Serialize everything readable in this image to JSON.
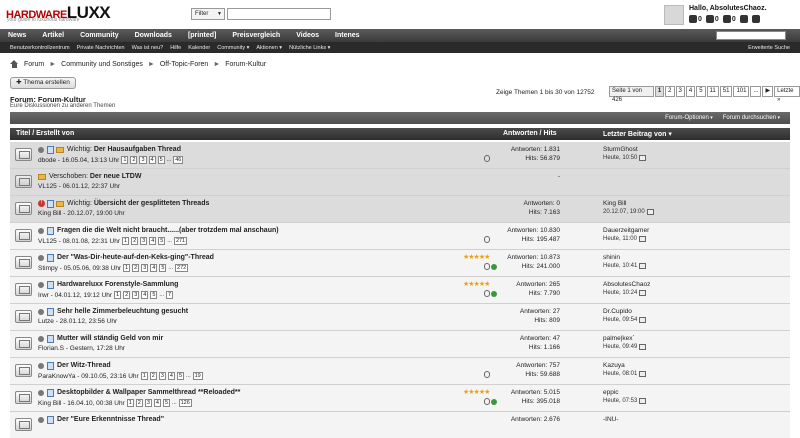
{
  "brand": {
    "logo_part1": "HARDWARE",
    "logo_part2": "LUXX",
    "tagline": "your guide to luxurious hardware"
  },
  "header": {
    "filter_label": "Filter",
    "search_placeholder": "",
    "greeting": "Hallo, AbsolutesChaoz.",
    "counts": [
      "0",
      "0",
      "0"
    ]
  },
  "nav": {
    "items": [
      "News",
      "Artikel",
      "Community",
      "Downloads",
      "[printed]",
      "Preisvergleich",
      "Videos",
      "Intenes"
    ]
  },
  "subnav": {
    "items": [
      "Benutzerkontrollzentrum",
      "Private Nachrichten",
      "Was ist neu?",
      "Hilfe",
      "Kalender",
      "Community ▾",
      "Aktionen ▾",
      "Nützliche Links ▾"
    ],
    "advanced": "Erweiterte Suche"
  },
  "breadcrumb": [
    "Forum",
    "Community und Sonstiges",
    "Off-Topic-Foren",
    "Forum-Kultur"
  ],
  "new_thread_label": "✚ Thema erstellen",
  "forum": {
    "title": "Forum: Forum-Kultur",
    "description": "Eure Diskussionen zu anderen Themen"
  },
  "showing": "Zeige Themen 1 bis 30 von 12752",
  "pager": {
    "label": "Seite 1 von 426",
    "pages": [
      "1",
      "2",
      "3",
      "4",
      "5",
      "11",
      "51",
      "101",
      "...",
      "▶"
    ],
    "last": "Letzte »"
  },
  "toolbar": {
    "options": "Forum-Optionen",
    "search": "Forum durchsuchen"
  },
  "columns": {
    "title": "Titel / Erstellt von",
    "replies": "Antworten / Hits",
    "last": "Letzter Beitrag von ▾"
  },
  "threads": [
    {
      "prefix": "Wichtig:",
      "title": "Der Hausaufgaben Thread",
      "author": "dbode - 16.05.04, 13:13 Uhr",
      "pages": [
        "1",
        "2",
        "3",
        "4",
        "5"
      ],
      "last_page": "46",
      "replies": "Antworten: 1.831",
      "hits": "Hits: 56.879",
      "last_user": "SturmGhost",
      "last_time": "Heute, 10:50",
      "sticky": true,
      "stars": "",
      "moved": false
    },
    {
      "prefix": "Verschoben:",
      "title": "Der neue LTDW",
      "author": "VL125 - 06.01.12, 22:37 Uhr",
      "pages": [],
      "last_page": "",
      "replies": "-",
      "hits": "",
      "last_user": "",
      "last_time": "",
      "sticky": true,
      "stars": "",
      "moved": true
    },
    {
      "prefix": "Wichtig:",
      "title": "Übersicht der gesplitteten Threads",
      "author": "King Bill - 20.12.07, 19:00 Uhr",
      "pages": [],
      "last_page": "",
      "replies": "Antworten: 0",
      "hits": "Hits: 7.163",
      "last_user": "King Bill",
      "last_time": "20.12.07, 19:00",
      "sticky": true,
      "stars": "",
      "moved": false
    },
    {
      "prefix": "",
      "title": "Fragen die die Welt nicht braucht......(aber trotzdem mal anschaun)",
      "author": "VL125 - 08.01.08, 22:31 Uhr",
      "pages": [
        "1",
        "2",
        "3",
        "4",
        "5"
      ],
      "last_page": "271",
      "replies": "Antworten: 10.830",
      "hits": "Hits: 195.487",
      "last_user": "Dauerzeitgamer",
      "last_time": "Heute, 11:00",
      "sticky": false,
      "stars": "",
      "moved": false
    },
    {
      "prefix": "",
      "title": "Der \"Was-Dir-heute-auf-den-Keks-ging\"-Thread",
      "author": "Stimpy - 05.05.06, 09:38 Uhr",
      "pages": [
        "1",
        "2",
        "3",
        "4",
        "5"
      ],
      "last_page": "272",
      "replies": "Antworten: 10.873",
      "hits": "Hits: 241.000",
      "last_user": "shinin",
      "last_time": "Heute, 10:41",
      "sticky": false,
      "stars": "★★★★★",
      "moved": false
    },
    {
      "prefix": "",
      "title": "Hardwareluxx Forenstyle-Sammlung",
      "author": "Irwr - 04.01.12, 19:12 Uhr",
      "pages": [
        "1",
        "2",
        "3",
        "4",
        "5"
      ],
      "last_page": "7",
      "replies": "Antworten: 265",
      "hits": "Hits: 7.790",
      "last_user": "AbsolutesChaoz",
      "last_time": "Heute, 10:24",
      "sticky": false,
      "stars": "★★★★★",
      "moved": false
    },
    {
      "prefix": "",
      "title": "Sehr helle Zimmerbeleuchtung gesucht",
      "author": "Lutze - 28.01.12, 23:56 Uhr",
      "pages": [],
      "last_page": "",
      "replies": "Antworten: 27",
      "hits": "Hits: 809",
      "last_user": "Dr.Cupido",
      "last_time": "Heute, 09:54",
      "sticky": false,
      "stars": "",
      "moved": false
    },
    {
      "prefix": "",
      "title": "Mutter will ständig Geld von mir",
      "author": "Florian.S - Gestern, 17:28 Uhr",
      "pages": [],
      "last_page": "",
      "replies": "Antworten: 47",
      "hits": "Hits: 1.166",
      "last_user": "palme|kex`",
      "last_time": "Heute, 09:49",
      "sticky": false,
      "stars": "",
      "moved": false
    },
    {
      "prefix": "",
      "title": "Der Witz-Thread",
      "author": "ParaKnowYa - 09.10.05, 23:16 Uhr",
      "pages": [
        "1",
        "2",
        "3",
        "4",
        "5"
      ],
      "last_page": "19",
      "replies": "Antworten: 757",
      "hits": "Hits: 59.688",
      "last_user": "Kazuya",
      "last_time": "Heute, 08:01",
      "sticky": false,
      "stars": "",
      "moved": false
    },
    {
      "prefix": "",
      "title": "Desktopbilder & Wallpaper Sammelthread **Reloaded**",
      "author": "King Bill - 16.04.10, 00:38 Uhr",
      "pages": [
        "1",
        "2",
        "3",
        "4",
        "5"
      ],
      "last_page": "126",
      "replies": "Antworten: 5.015",
      "hits": "Hits: 395.018",
      "last_user": "eppic",
      "last_time": "Heute, 07:53",
      "sticky": false,
      "stars": "★★★★★",
      "moved": false
    },
    {
      "prefix": "",
      "title": "Der \"Eure Erkenntnisse Thread\"",
      "author": "",
      "pages": [],
      "last_page": "",
      "replies": "Antworten: 2.676",
      "hits": "",
      "last_user": "-INU-",
      "last_time": "",
      "sticky": false,
      "stars": "",
      "moved": false
    }
  ]
}
